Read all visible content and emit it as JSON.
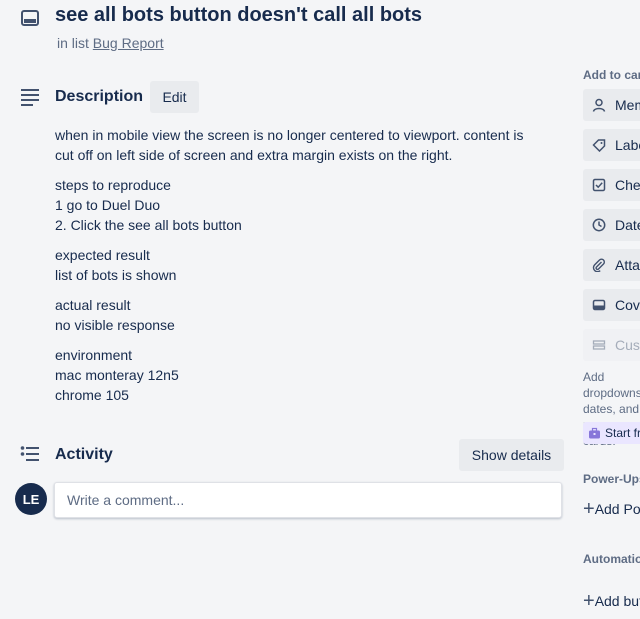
{
  "card": {
    "title": "see all bots button doesn't call all bots",
    "in_list_prefix": "in list",
    "list_name": "Bug Report"
  },
  "description": {
    "heading": "Description",
    "edit_label": "Edit",
    "paragraphs": [
      [
        "when in mobile view the screen is no longer centered to viewport. content is",
        "cut off on left side of screen and extra margin exists on the right."
      ],
      [
        "steps to reproduce",
        "1 go to Duel Duo",
        "2. Click the see all bots button"
      ],
      [
        "expected result",
        "list of bots is shown"
      ],
      [
        "actual result",
        "no visible response"
      ],
      [
        "environment",
        "mac monteray 12n5",
        "chrome 105"
      ]
    ]
  },
  "activity": {
    "heading": "Activity",
    "show_details_label": "Show details",
    "avatar_initials": "LE",
    "comment_placeholder": "Write a comment..."
  },
  "sidebar": {
    "add_to_card_label": "Add to card",
    "buttons": [
      {
        "label": "Members",
        "icon": "person-icon"
      },
      {
        "label": "Labels",
        "icon": "tag-icon"
      },
      {
        "label": "Checklist",
        "icon": "checkbox-icon"
      },
      {
        "label": "Dates",
        "icon": "clock-icon"
      },
      {
        "label": "Attachment",
        "icon": "paperclip-icon"
      },
      {
        "label": "Cover",
        "icon": "cover-icon"
      },
      {
        "label": "Custom Fields",
        "icon": "custom-fields-icon",
        "disabled": true
      }
    ],
    "note_lines": [
      "Add dropdowns,",
      "dates, and more",
      "cards."
    ],
    "start_trial_label": "Start free trial",
    "powerups_label": "Power-Ups",
    "powerups_add_label": "Add Power-Ups",
    "automation_label": "Automation",
    "automation_add_label": "Add button"
  },
  "colors": {
    "text": "#172b4d",
    "muted": "#5e6c84",
    "button_bg": "#e9ebee",
    "background": "#f4f5f7",
    "trial_bg": "#eae6ff",
    "trial_icon": "#8777d9"
  }
}
